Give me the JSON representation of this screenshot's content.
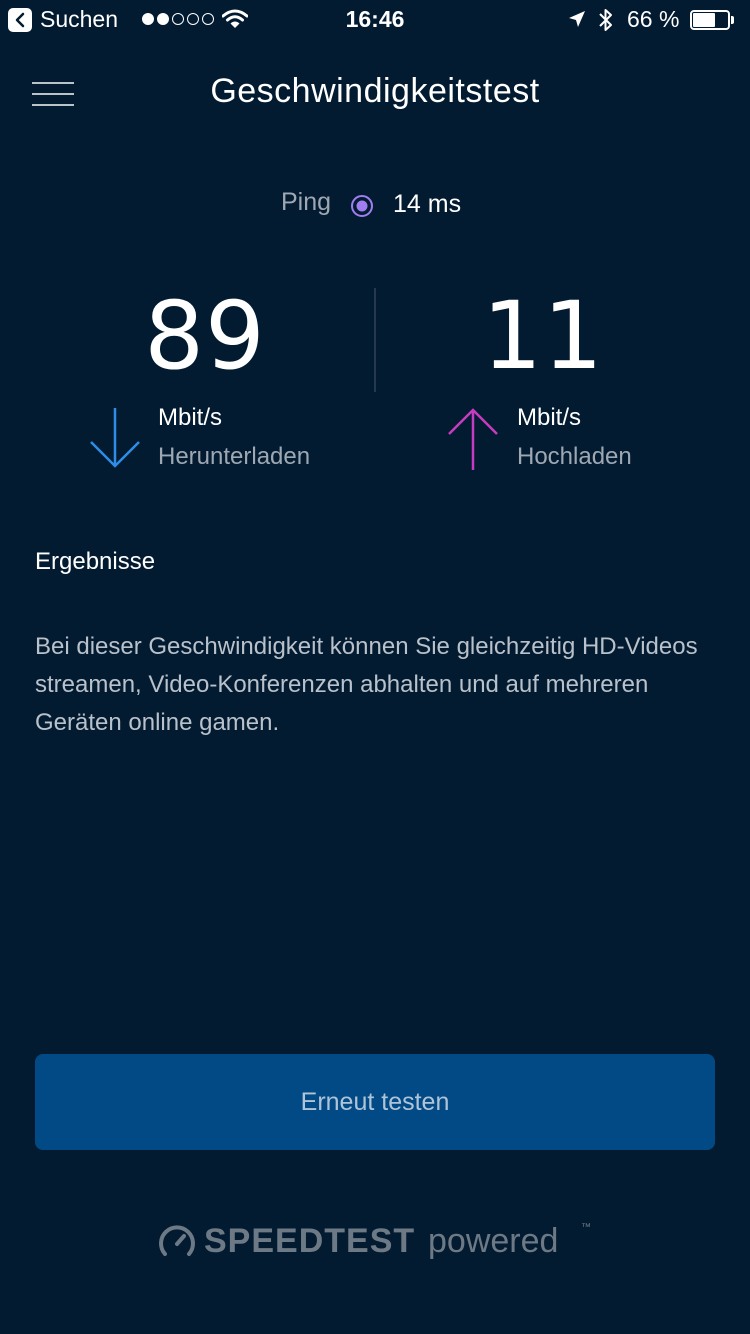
{
  "status_bar": {
    "carrier": "Suchen",
    "signal_bars_filled": 2,
    "signal_bars_total": 5,
    "time": "16:46",
    "battery_text": "66 %",
    "battery_level": 0.66
  },
  "header": {
    "title": "Geschwindigkeitstest"
  },
  "ping": {
    "label": "Ping",
    "value": "14 ms",
    "color": "#a07df0"
  },
  "download": {
    "value": "89",
    "unit": "Mbit/s",
    "label": "Herunterladen",
    "color": "#2e8de6"
  },
  "upload": {
    "value": "11",
    "unit": "Mbit/s",
    "label": "Hochladen",
    "color": "#c63cc0"
  },
  "results": {
    "title": "Ergebnisse",
    "text": "Bei dieser Geschwindigkeit können Sie gleichzeitig HD-Videos streamen, Video-Konferenzen abhalten und auf mehreren Geräten online gamen."
  },
  "actions": {
    "retest_label": "Erneut testen"
  },
  "footer": {
    "brand": "SPEEDTEST",
    "powered": "powered",
    "tm": "™"
  },
  "icons": {
    "menu": "hamburger-menu-icon",
    "ping": "ping-dot-icon",
    "download": "arrow-down-icon",
    "upload": "arrow-up-icon",
    "speedtest": "speedometer-icon"
  }
}
